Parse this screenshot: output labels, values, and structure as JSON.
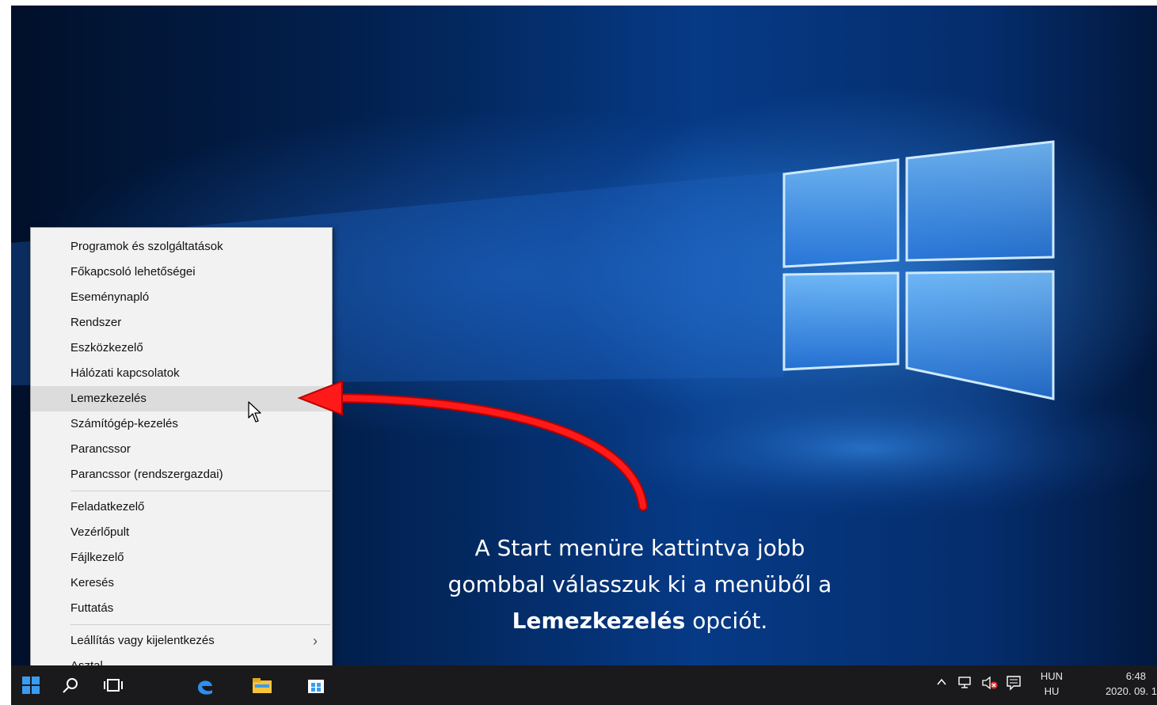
{
  "context_menu": {
    "items": [
      {
        "label": "Programok és szolgáltatások"
      },
      {
        "label": "Főkapcsoló lehetőségei"
      },
      {
        "label": "Eseménynapló"
      },
      {
        "label": "Rendszer"
      },
      {
        "label": "Eszközkezelő"
      },
      {
        "label": "Hálózati kapcsolatok"
      },
      {
        "label": "Lemezkezelés",
        "highlighted": true
      },
      {
        "label": "Számítógép-kezelés"
      },
      {
        "label": "Parancssor"
      },
      {
        "label": "Parancssor (rendszergazdai)"
      },
      {
        "label": "Feladatkezelő"
      },
      {
        "label": "Vezérlőpult"
      },
      {
        "label": "Fájlkezelő"
      },
      {
        "label": "Keresés"
      },
      {
        "label": "Futtatás"
      },
      {
        "label": "Leállítás vagy kijelentkezés",
        "submenu_icon": "chevron-right-icon"
      },
      {
        "label": "Asztal"
      }
    ]
  },
  "caption": {
    "line1": "A Start menüre kattintva jobb",
    "line2": "gombbal válasszuk ki a menüből a",
    "bold": "Lemezkezelés",
    "rest": " opciót."
  },
  "taskbar": {
    "icons": [
      "windows-start-icon",
      "search-icon",
      "task-view-icon",
      "edge-icon",
      "file-explorer-icon",
      "store-icon"
    ],
    "tray": {
      "icons": [
        "chevron-up-icon",
        "network-icon",
        "volume-muted-icon",
        "notification-icon"
      ],
      "lang_top": "HUN",
      "lang_bottom": "HU",
      "time": "6:48",
      "date": "2020. 09. 1"
    }
  },
  "colors": {
    "accent_arrow": "#e00000",
    "taskbar_bg": "#1a1a1c",
    "menu_bg": "#f2f2f2",
    "menu_highlight": "#dcdcdc",
    "window_glow": "#4aa8ff"
  }
}
